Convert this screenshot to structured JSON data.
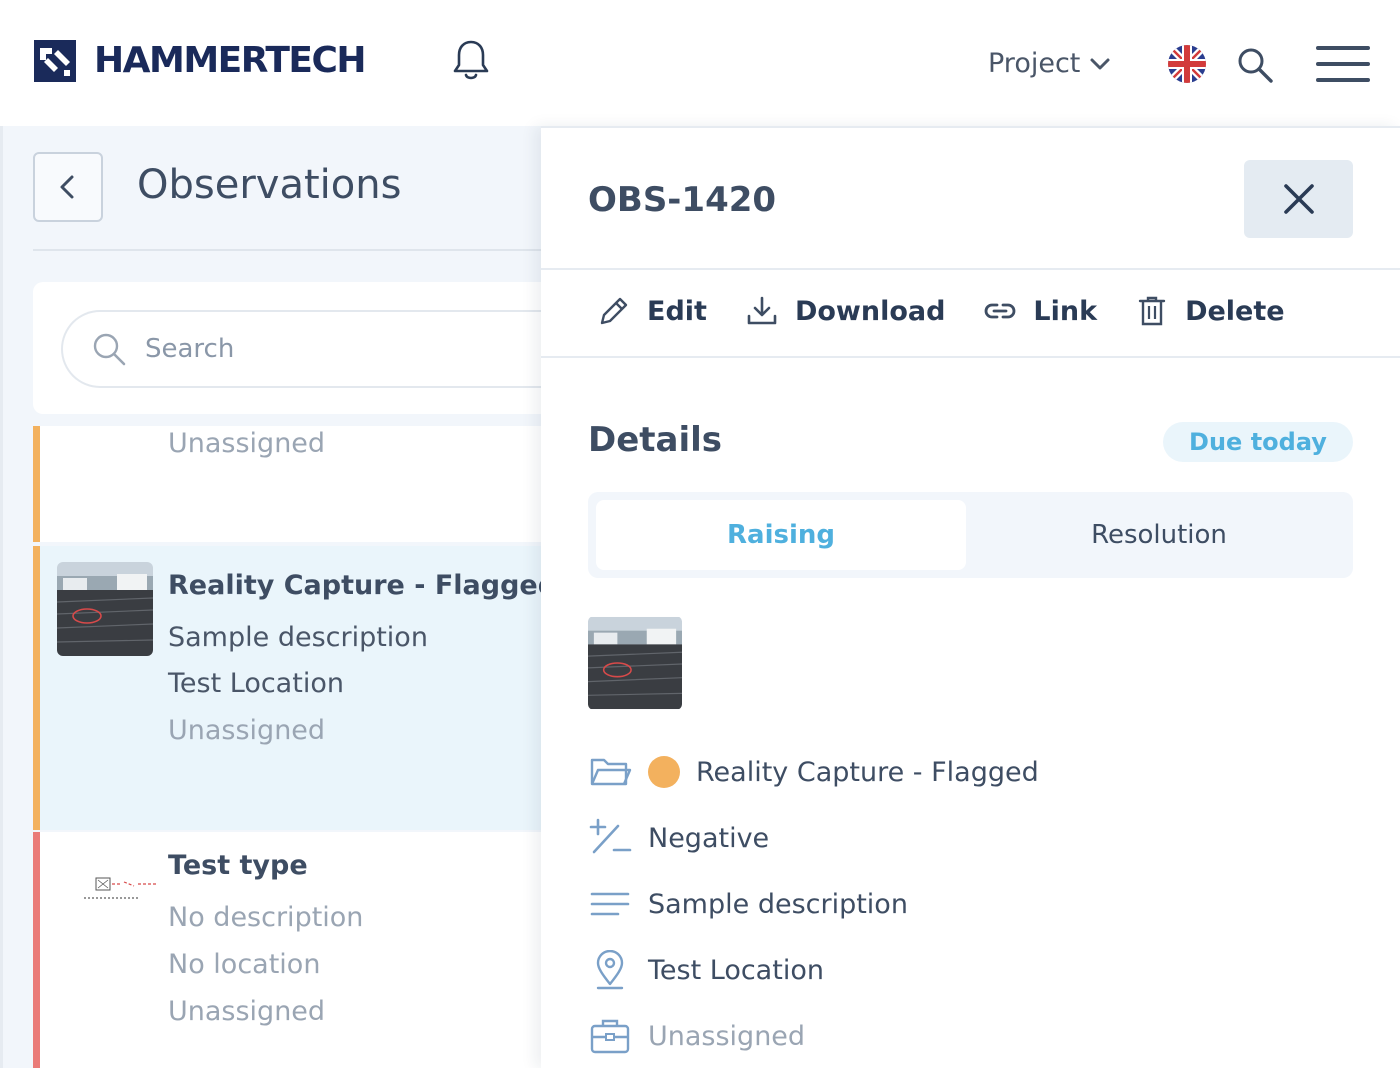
{
  "header": {
    "brand": "HAMMERTECH",
    "project_label": "Project"
  },
  "list": {
    "title": "Observations",
    "search_placeholder": "Search",
    "cards": [
      {
        "assignee": "Unassigned",
        "color": "#f3b15e"
      },
      {
        "title": "Reality Capture - Flagged",
        "description": "Sample description",
        "location": "Test Location",
        "assignee": "Unassigned",
        "color": "#f3b15e"
      },
      {
        "title": "Test type",
        "description": "No description",
        "location": "No location",
        "assignee": "Unassigned",
        "color": "#ea7b78"
      }
    ]
  },
  "detail": {
    "id": "OBS-1420",
    "actions": {
      "edit": "Edit",
      "download": "Download",
      "link": "Link",
      "delete": "Delete"
    },
    "section_title": "Details",
    "due_badge": "Due today",
    "tabs": {
      "raising": "Raising",
      "resolution": "Resolution"
    },
    "rows": {
      "type": "Reality Capture - Flagged",
      "sentiment": "Negative",
      "description": "Sample description",
      "location": "Test Location",
      "assignee": "Unassigned"
    }
  },
  "colors": {
    "accent": "#4fb0de",
    "brand": "#1a2a5a",
    "status_orange": "#f3b15e",
    "status_red": "#ea7b78"
  }
}
